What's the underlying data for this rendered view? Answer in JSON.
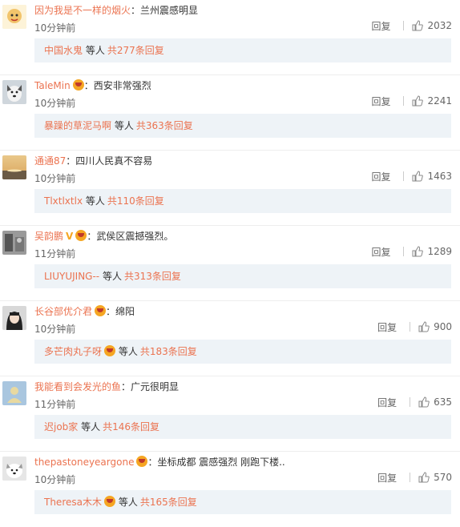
{
  "comments": [
    {
      "user": "因为我是不一样的烟火",
      "badge": false,
      "vip": false,
      "text": "兰州震感明显",
      "time": "10分钟前",
      "reply": "回复",
      "likes": "2032",
      "sub_user": "中国水鬼",
      "sub_badge": false,
      "sub_etc": "等人",
      "sub_total": "共277条回复",
      "avatar": "avatar-cartoon"
    },
    {
      "user": "TaleMin",
      "badge": true,
      "vip": false,
      "text": "西安非常强烈",
      "time": "10分钟前",
      "reply": "回复",
      "likes": "2241",
      "sub_user": "暴躁的草泥马啊",
      "sub_badge": false,
      "sub_etc": "等人",
      "sub_total": "共363条回复",
      "avatar": "avatar-dog"
    },
    {
      "user": "通通87",
      "badge": false,
      "vip": false,
      "text": "四川人民真不容易",
      "time": "10分钟前",
      "reply": "回复",
      "likes": "1463",
      "sub_user": "Tlxtlxtlx",
      "sub_badge": false,
      "sub_etc": "等人",
      "sub_total": "共110条回复",
      "avatar": "avatar-sunset"
    },
    {
      "user": "吴韵鹏",
      "badge": true,
      "vip": true,
      "text": "武侯区震撼强烈。",
      "time": "11分钟前",
      "reply": "回复",
      "likes": "1289",
      "sub_user": "LIUYUJING--",
      "sub_badge": false,
      "sub_etc": "等人",
      "sub_total": "共313条回复",
      "avatar": "avatar-photo"
    },
    {
      "user": "长谷部优介君",
      "badge": true,
      "vip": false,
      "text": "绵阳",
      "time": "10分钟前",
      "reply": "回复",
      "likes": "900",
      "sub_user": "多芒肉丸子呀",
      "sub_badge": true,
      "sub_etc": "等人",
      "sub_total": "共183条回复",
      "avatar": "avatar-girl"
    },
    {
      "user": "我能看到会发光的鱼",
      "badge": false,
      "vip": false,
      "text": "广元很明显",
      "time": "11分钟前",
      "reply": "回复",
      "likes": "635",
      "sub_user": "迟job家",
      "sub_badge": false,
      "sub_etc": "等人",
      "sub_total": "共146条回复",
      "avatar": "avatar-default"
    },
    {
      "user": "thepastoneyeargone",
      "badge": true,
      "vip": false,
      "text": "坐标成都 震感强烈 刚跑下楼..",
      "time": "10分钟前",
      "reply": "回复",
      "likes": "570",
      "sub_user": "Theresa木木",
      "sub_badge": true,
      "sub_etc": "等人",
      "sub_total": "共165条回复",
      "avatar": "avatar-dog2"
    }
  ],
  "colors": {
    "username": "#eb7350",
    "subbox": "#eef3f7",
    "text": "#333333",
    "meta": "#666666"
  },
  "icons": {
    "like": "thumbs-up-icon",
    "badge": "member-badge-icon",
    "vip": "verified-v-icon"
  }
}
